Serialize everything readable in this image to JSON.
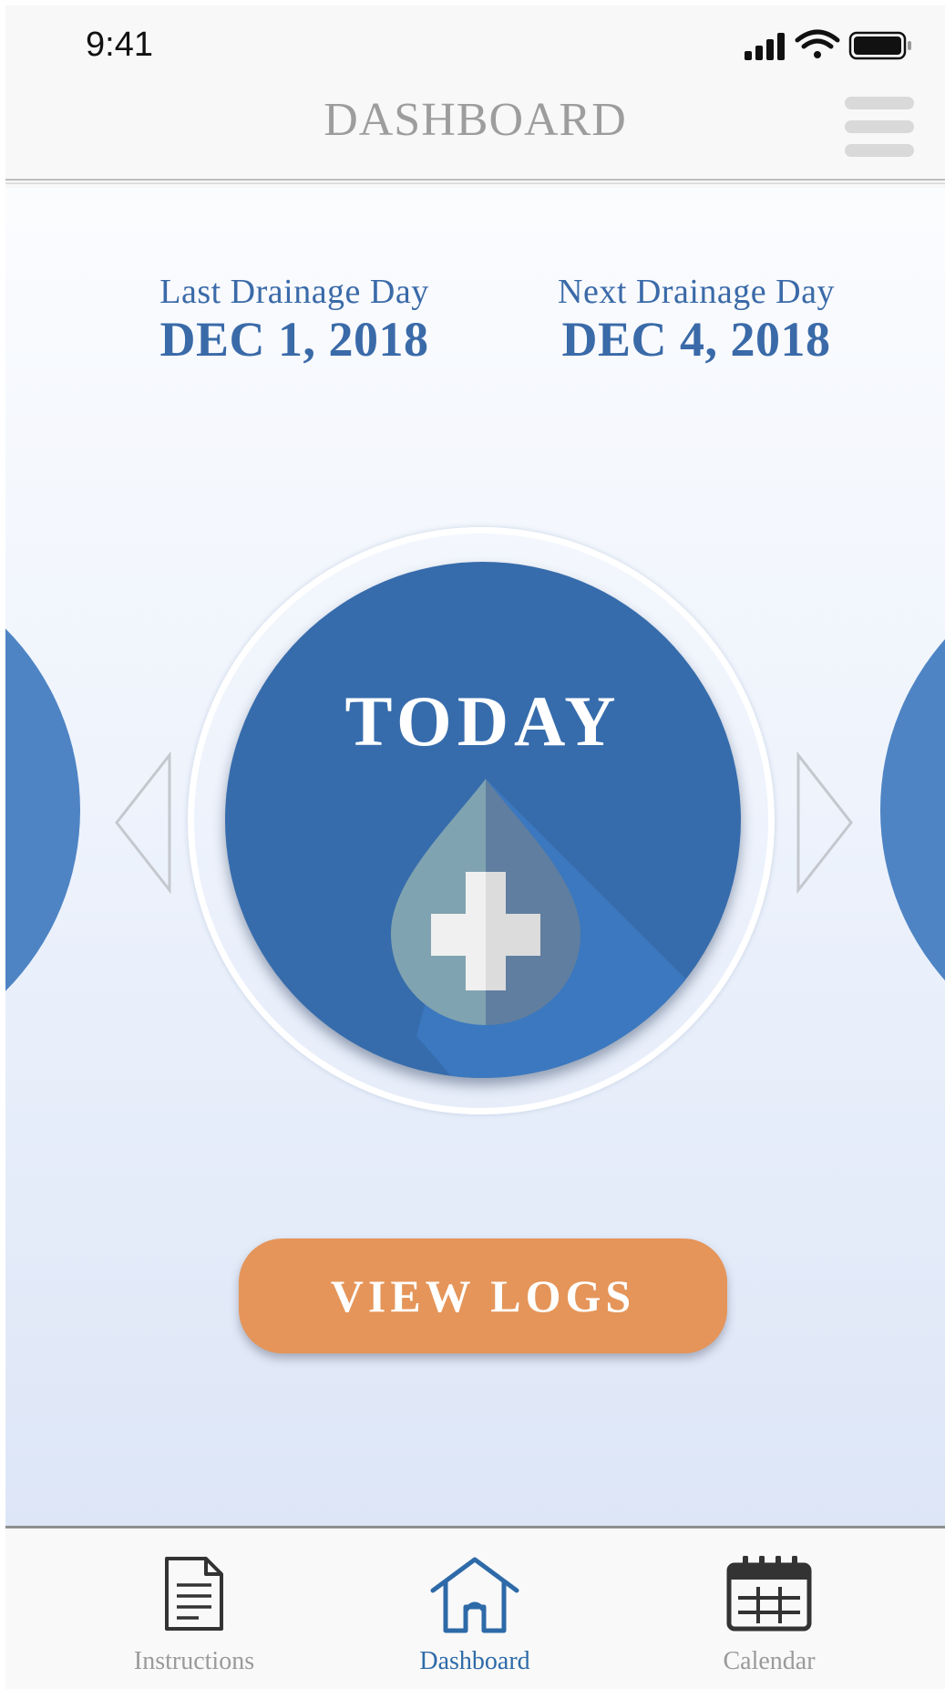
{
  "status_bar": {
    "time": "9:41",
    "icons": [
      "cellular-signal-icon",
      "wifi-icon",
      "battery-icon"
    ]
  },
  "header": {
    "title": "DASHBOARD",
    "menu_icon": "hamburger-menu-icon"
  },
  "drainage": {
    "last_label": "Last Drainage Day",
    "last_date": "DEC 1, 2018",
    "next_label": "Next Drainage Day",
    "next_date": "DEC 4, 2018"
  },
  "carousel": {
    "current_label": "TODAY",
    "icon": "medical-drop-plus-icon",
    "prev_icon": "arrow-left-icon",
    "next_icon": "arrow-right-icon"
  },
  "actions": {
    "view_logs_label": "VIEW LOGS"
  },
  "tab_bar": {
    "active": "Dashboard",
    "tabs": [
      {
        "label": "Instructions",
        "icon": "document-icon"
      },
      {
        "label": "Dashboard",
        "icon": "home-icon"
      },
      {
        "label": "Calendar",
        "icon": "calendar-icon"
      }
    ]
  },
  "colors": {
    "primary_blue": "#366cac",
    "side_blue": "#4e84c4",
    "accent_orange": "#e59559",
    "text_blue": "#3a6aa8",
    "header_gray": "#9d9d9d",
    "tab_active": "#2e6aa8",
    "tab_inactive": "#9a9a9a"
  }
}
